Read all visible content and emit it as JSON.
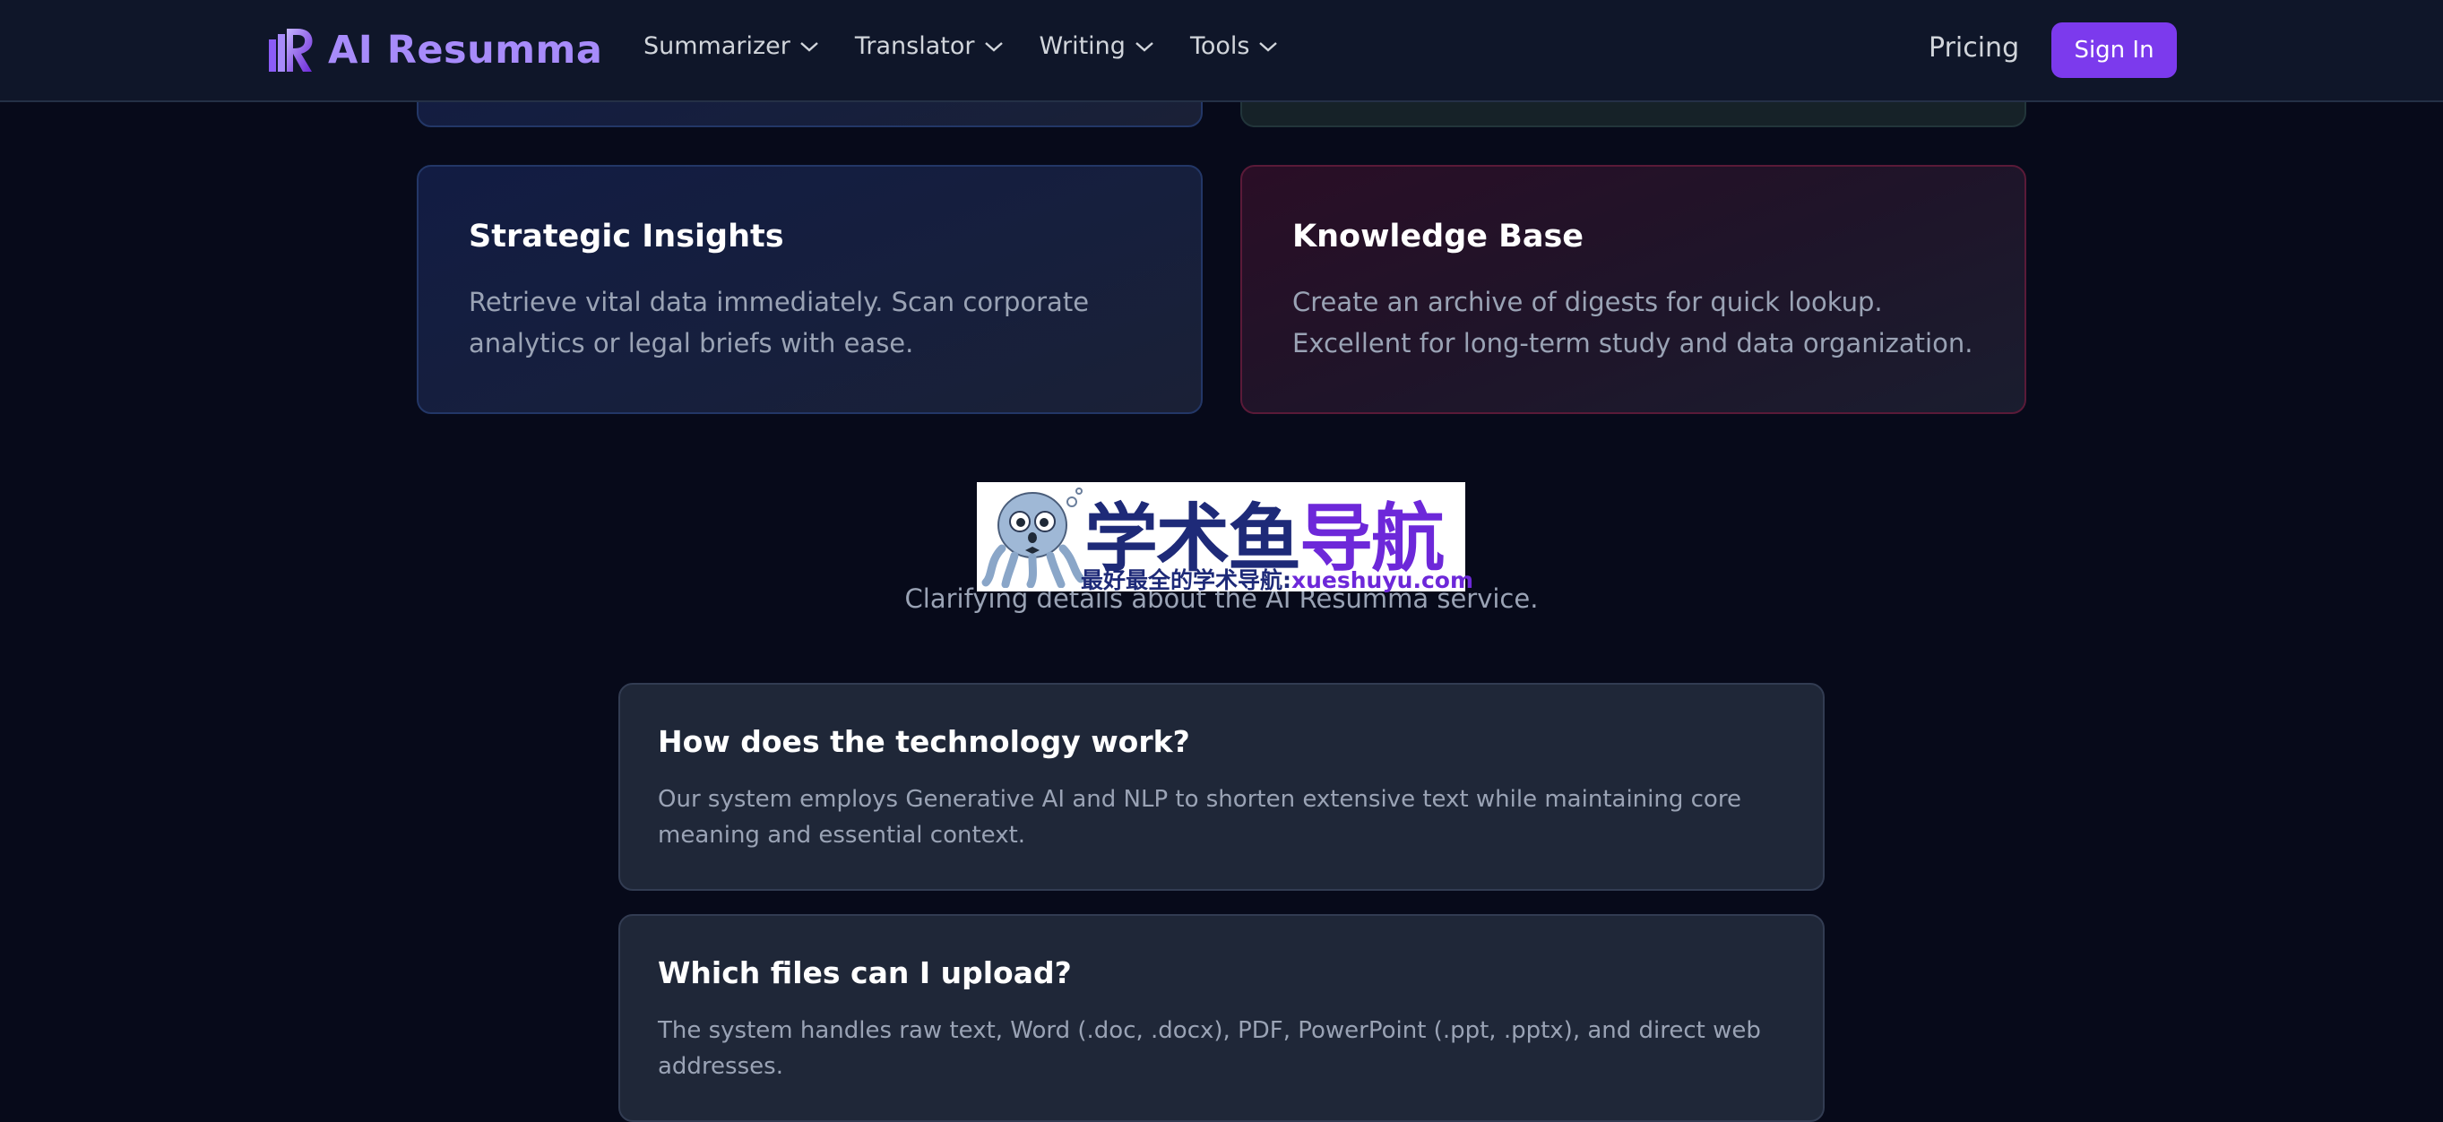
{
  "brand": {
    "name": "AI Resumma",
    "color": "#a78bfa"
  },
  "nav": {
    "menu": [
      {
        "label": "Summarizer",
        "icon": "chevron-down-icon"
      },
      {
        "label": "Translator",
        "icon": "chevron-down-icon"
      },
      {
        "label": "Writing",
        "icon": "chevron-down-icon"
      },
      {
        "label": "Tools",
        "icon": "chevron-down-icon"
      }
    ],
    "pricing_label": "Pricing",
    "signin_label": "Sign In",
    "accent": "#7c3aed"
  },
  "features": [
    {
      "title": "Strategic Insights",
      "text": "Retrieve vital data immediately. Scan corporate analytics or legal briefs with ease."
    },
    {
      "title": "Knowledge Base",
      "text": "Create an archive of digests for quick lookup. Excellent for long-term study and data organization."
    }
  ],
  "watermark": {
    "big_dark": "学术鱼",
    "big_purple": "导航",
    "small_dark": "最好最全的学术导航:",
    "small_purple": "xueshuyu.com"
  },
  "faq": {
    "subtitle": "Clarifying details about the AI Resumma service.",
    "items": [
      {
        "question": "How does the technology work?",
        "answer": "Our system employs Generative AI and NLP to shorten extensive text while maintaining core meaning and essential context."
      },
      {
        "question": "Which files can I upload?",
        "answer": "The system handles raw text, Word (.doc, .docx), PDF, PowerPoint (.ppt, .pptx), and direct web addresses."
      }
    ]
  }
}
